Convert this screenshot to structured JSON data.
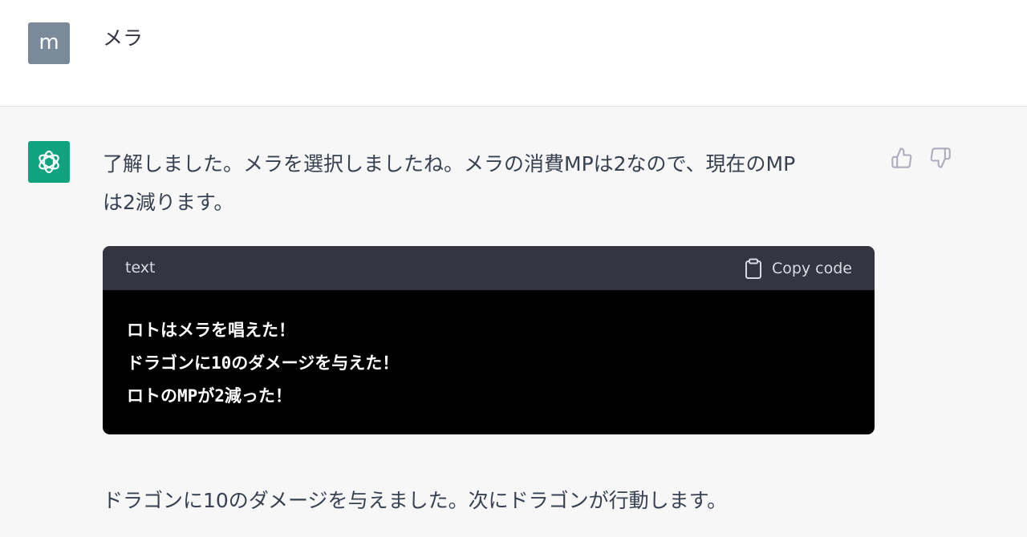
{
  "user_message": {
    "avatar_letter": "m",
    "text": "メラ"
  },
  "assistant_message": {
    "avatar_icon": "openai-logo-icon",
    "paragraph_lines": [
      "了解しました。メラを選択しましたね。メラの消費MPは2なので、現在のMP",
      "は2減ります。"
    ],
    "code_block": {
      "language": "text",
      "copy_label": "Copy code",
      "lines": [
        "ロトはメラを唱えた！",
        "ドラゴンに10のダメージを与えた！",
        "ロトのMPが2減った！"
      ]
    },
    "after_text": "ドラゴンに10のダメージを与えました。次にドラゴンが行動します。"
  },
  "icons": {
    "thumbs_up": "thumbs-up-icon",
    "thumbs_down": "thumbs-down-icon",
    "clipboard": "clipboard-icon"
  },
  "colors": {
    "user_avatar": "#7b8a99",
    "assistant_avatar": "#10a37f",
    "assistant_background": "#f7f7f8",
    "code_header": "#343541",
    "code_body": "#000000"
  }
}
